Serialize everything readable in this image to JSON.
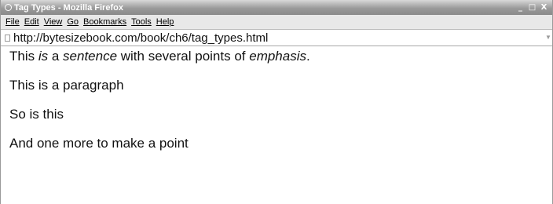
{
  "window": {
    "title": "Tag Types - Mozilla Firefox",
    "controls": {
      "minimize": "_",
      "maximize": "□",
      "close": "X"
    }
  },
  "menubar": {
    "items": [
      "File",
      "Edit",
      "View",
      "Go",
      "Bookmarks",
      "Tools",
      "Help"
    ]
  },
  "urlbar": {
    "url": "http://bytesizebook.com/book/ch6/tag_types.html"
  },
  "page": {
    "sentence": {
      "part1": "This ",
      "em1": "is",
      "part2": " a ",
      "em2": "sentence",
      "part3": " with several points of ",
      "em3": "emphasis",
      "part4": "."
    },
    "paragraph1": "This is a paragraph",
    "paragraph2": "So is this",
    "paragraph3": "And one more to make a point"
  },
  "colors": {
    "titlebar": "#9a9a9a",
    "menubar": "#e8e8e8",
    "text": "#111111"
  }
}
